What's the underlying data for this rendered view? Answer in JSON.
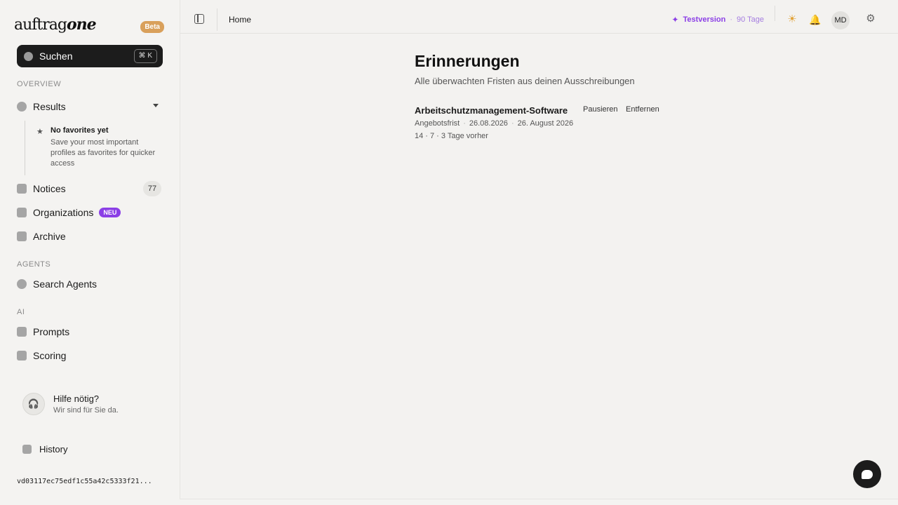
{
  "brand": {
    "logo_light": "auftrag",
    "logo_bold": "one",
    "beta": "Beta"
  },
  "search": {
    "label": "Suchen",
    "shortcut": "⌘ K"
  },
  "sidebar": {
    "overview_label": "OVERVIEW",
    "results": "Results",
    "favorites_title": "No favorites yet",
    "favorites_desc": "Save your most important profiles as favorites for quicker access",
    "notices": "Notices",
    "notices_count": "77",
    "organizations": "Organizations",
    "organizations_badge": "NEU",
    "archive": "Archive",
    "agents_label": "AGENTS",
    "search_agents": "Search Agents",
    "ai_label": "AI",
    "prompts": "Prompts",
    "scoring": "Scoring",
    "help_title": "Hilfe nötig?",
    "help_sub": "Wir sind für Sie da.",
    "history": "History",
    "version": "vd03117ec75edf1c55a42c5333f21..."
  },
  "topbar": {
    "breadcrumb": "Home",
    "trial_label": "Testversion",
    "trial_days": "90 Tage",
    "avatar": "MD"
  },
  "main": {
    "title": "Erinnerungen",
    "subtitle": "Alle überwachten Fristen aus deinen Ausschreibungen",
    "reminder": {
      "title": "Arbeitschutzmanagement-Software",
      "pause": "Pausieren",
      "remove": "Entfernen",
      "type": "Angebotsfrist",
      "date_short": "26.08.2026",
      "date_long": "26. August 2026",
      "days": "14 · 7 · 3 Tage vorher"
    }
  },
  "colors": {
    "accent": "#8b3fe6",
    "beta": "#d9a05b",
    "dark": "#1c1c1c"
  }
}
